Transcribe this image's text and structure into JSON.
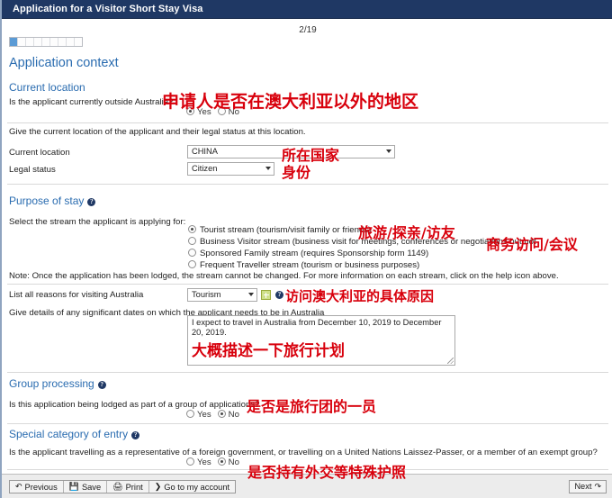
{
  "header": {
    "title": "Application for a Visitor Short Stay Visa"
  },
  "progress": {
    "page_label": "2/19",
    "segments_total": 9,
    "segments_filled": 1,
    "fill_color": "#5b9bd5"
  },
  "page_heading": "Application context",
  "sections": {
    "current_location": {
      "heading": "Current location",
      "question": "Is the applicant currently outside Australia?",
      "options": [
        {
          "label": "Yes",
          "selected": true
        },
        {
          "label": "No",
          "selected": false
        }
      ],
      "instruction": "Give the current location of the applicant and their legal status at this location.",
      "fields": [
        {
          "label": "Current location",
          "value": "CHINA",
          "type": "select"
        },
        {
          "label": "Legal status",
          "value": "Citizen",
          "type": "select"
        }
      ]
    },
    "purpose_of_stay": {
      "heading": "Purpose of stay",
      "has_help_icon": true,
      "prompt": "Select the stream the applicant is applying for:",
      "streams": [
        {
          "label": "Tourist stream (tourism/visit family or friends)",
          "selected": true
        },
        {
          "label": "Business Visitor stream (business visit for meetings, conferences or negotiations but not",
          "selected": false
        },
        {
          "label": "Sponsored Family stream (requires Sponsorship form 1149)",
          "selected": false
        },
        {
          "label": "Frequent Traveller stream (tourism or business purposes)",
          "selected": false
        }
      ],
      "note": "Note: Once the application has been lodged, the stream cannot be changed. For more information on each stream, click on the help icon above.",
      "reasons_label": "List all reasons for visiting Australia",
      "reasons_value": "Tourism",
      "add_button_name": "add-reason-button",
      "dates_label": "Give details of any significant dates on which the applicant needs to be in Australia",
      "dates_value": "I expect to travel in Australia from December 10, 2019 to December 20, 2019."
    },
    "group_processing": {
      "heading": "Group processing",
      "has_help_icon": true,
      "question": "Is this application being lodged as part of a group of applications?",
      "options": [
        {
          "label": "Yes",
          "selected": false
        },
        {
          "label": "No",
          "selected": true
        }
      ]
    },
    "special_category": {
      "heading": "Special category of entry",
      "has_help_icon": true,
      "question": "Is the applicant travelling as a representative of a foreign government, or travelling on a United Nations Laissez-Passer, or a member of an exempt group?",
      "options": [
        {
          "label": "Yes",
          "selected": false
        },
        {
          "label": "No",
          "selected": true
        }
      ]
    }
  },
  "footer": {
    "previous": "Previous",
    "save": "Save",
    "print": "Print",
    "account": "Go to my account",
    "next": "Next"
  },
  "annotations": {
    "a1": "申请人是否在澳大利亚以外的地区",
    "a2": "所在国家",
    "a3": "身份",
    "a4": "旅游/探亲/访友",
    "a5": "商务访问/会议",
    "a6": "访问澳大利亚的具体原因",
    "a7": "大概描述一下旅行计划",
    "a8": "是否是旅行团的一员",
    "a9": "是否持有外交等特殊护照",
    "color": "#d8000c"
  }
}
